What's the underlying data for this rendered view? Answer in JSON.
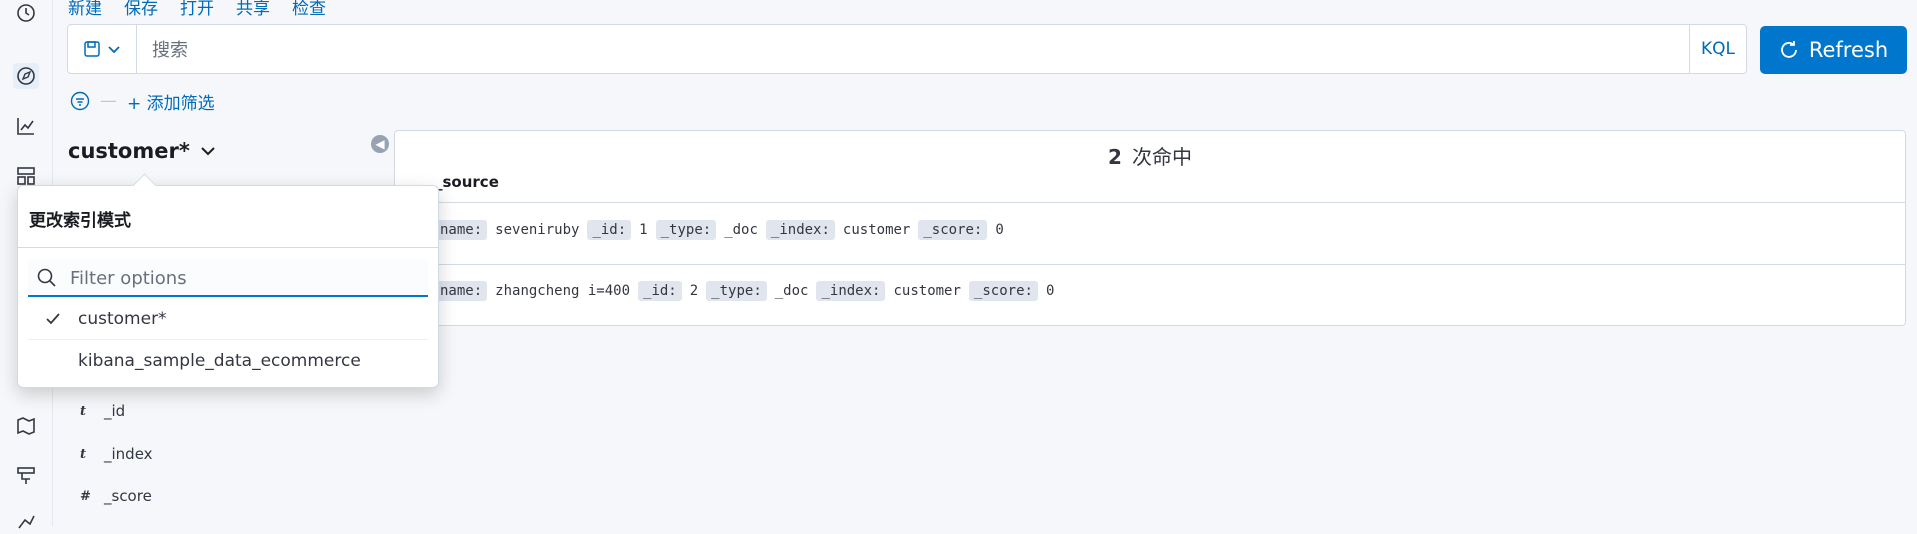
{
  "top_menu": {
    "new": "新建",
    "save": "保存",
    "open": "打开",
    "share": "共享",
    "inspect": "检查"
  },
  "query_bar": {
    "placeholder": "搜索",
    "language": "KQL",
    "refresh_label": "Refresh"
  },
  "filter": {
    "add_label": "+ 添加筛选"
  },
  "index_pattern": {
    "current": "customer*"
  },
  "popover": {
    "title": "更改索引模式",
    "filter_placeholder": "Filter options",
    "options": [
      {
        "label": "customer*",
        "selected": true
      },
      {
        "label": "kibana_sample_data_ecommerce",
        "selected": false
      }
    ]
  },
  "fields": [
    {
      "type": "t",
      "name": "_id"
    },
    {
      "type": "t",
      "name": "_index"
    },
    {
      "type": "#",
      "name": "_score"
    }
  ],
  "results": {
    "hit_count": "2",
    "hit_label": "次命中",
    "column": "_source",
    "rows": [
      {
        "name_key": "name:",
        "name_val": "seveniruby",
        "id_key": "_id:",
        "id_val": "1",
        "type_key": "_type:",
        "type_val": "_doc",
        "index_key": "_index:",
        "index_val": "customer",
        "score_key": "_score:",
        "score_val": "0"
      },
      {
        "name_key": "name:",
        "name_val": "zhangcheng i=400",
        "id_key": "_id:",
        "id_val": "2",
        "type_key": "_type:",
        "type_val": "_doc",
        "index_key": "_index:",
        "index_val": "customer",
        "score_key": "_score:",
        "score_val": "0"
      }
    ]
  },
  "colors": {
    "accent": "#0077cc",
    "link": "#006bb8",
    "background": "#f5f7fa"
  }
}
